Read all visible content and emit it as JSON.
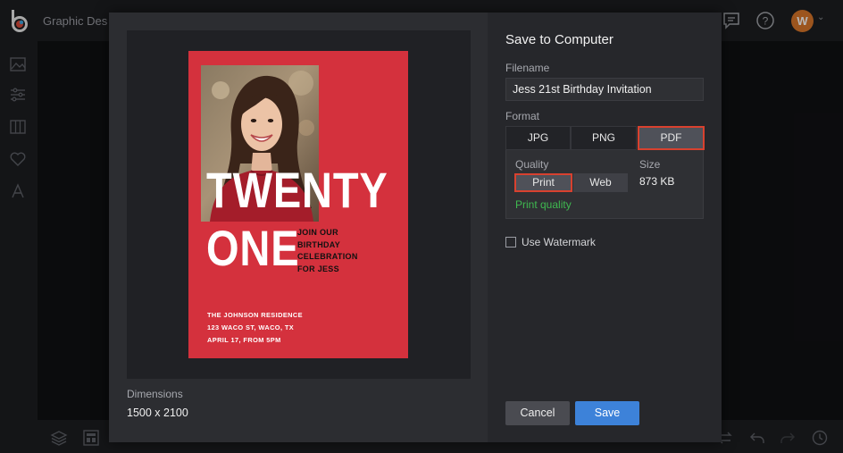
{
  "app": {
    "title": "Graphic Des",
    "avatar_initial": "W"
  },
  "dialog": {
    "title": "Save to Computer",
    "filename_label": "Filename",
    "filename_value": "Jess 21st Birthday Invitation",
    "format_label": "Format",
    "formats": [
      "JPG",
      "PNG",
      "PDF"
    ],
    "selected_format": "PDF",
    "quality_label": "Quality",
    "quality_options": [
      "Print",
      "Web"
    ],
    "selected_quality": "Print",
    "quality_note": "Print quality",
    "size_label": "Size",
    "size_value": "873 KB",
    "watermark_label": "Use Watermark",
    "watermark_checked": false,
    "dimensions_label": "Dimensions",
    "dimensions_value": "1500 x 2100",
    "cancel_label": "Cancel",
    "save_label": "Save"
  },
  "poster": {
    "line1": "TWENTY",
    "line2": "ONE",
    "tagline": [
      "JOIN OUR",
      "BIRTHDAY",
      "CELEBRATION",
      "FOR JESS"
    ],
    "address": [
      "THE JOHNSON RESIDENCE",
      "123 WACO ST, WACO, TX",
      "APRIL 17, FROM 5PM"
    ]
  },
  "colors": {
    "poster_red": "#d4313d",
    "selection_border": "#d8412f",
    "save_blue": "#3d82d9",
    "quality_green": "#3fb950"
  }
}
